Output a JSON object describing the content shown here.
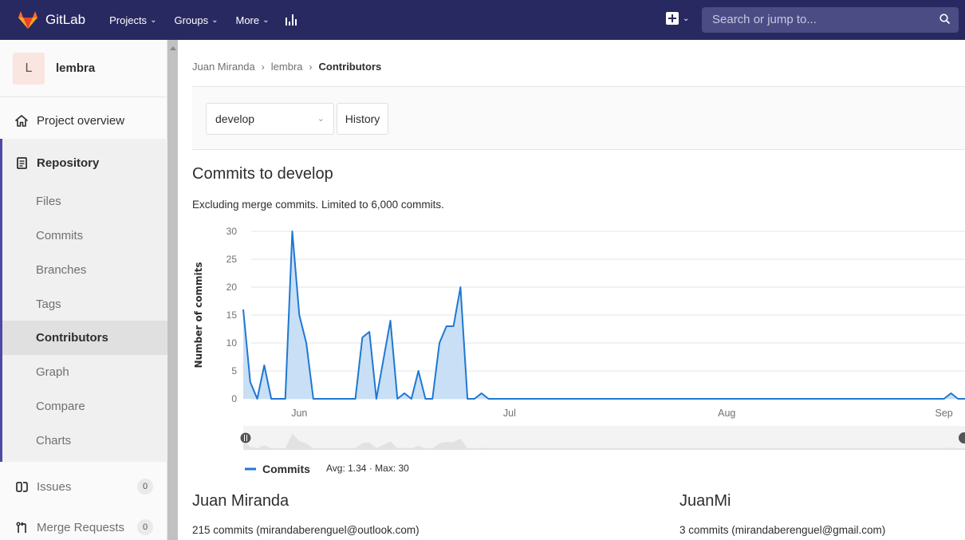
{
  "topbar": {
    "brand": "GitLab",
    "nav": [
      {
        "label": "Projects"
      },
      {
        "label": "Groups"
      },
      {
        "label": "More"
      }
    ],
    "search_placeholder": "Search or jump to...",
    "bg_color": "#292961"
  },
  "sidebar": {
    "project_initial": "L",
    "project_name": "lembra",
    "overview": "Project overview",
    "repository": "Repository",
    "repo_items": [
      "Files",
      "Commits",
      "Branches",
      "Tags",
      "Contributors",
      "Graph",
      "Compare",
      "Charts"
    ],
    "active_item": "Contributors",
    "issues": {
      "label": "Issues",
      "count": "0"
    },
    "merge_requests": {
      "label": "Merge Requests",
      "count": "0"
    }
  },
  "breadcrumb": {
    "items": [
      "Juan Miranda",
      "lembra"
    ],
    "current": "Contributors"
  },
  "controls": {
    "branch": "develop",
    "history_label": "History"
  },
  "section": {
    "title": "Commits to develop",
    "subtitle": "Excluding merge commits. Limited to 6,000 commits."
  },
  "chart_data": {
    "type": "area",
    "ylabel": "Number of commits",
    "ylim": [
      0,
      30
    ],
    "yticks": [
      0,
      5,
      10,
      15,
      20,
      25,
      30
    ],
    "month_labels": [
      {
        "label": "Jun",
        "day_index": 8
      },
      {
        "label": "Jul",
        "day_index": 38
      },
      {
        "label": "Aug",
        "day_index": 69
      },
      {
        "label": "Sep",
        "day_index": 100
      }
    ],
    "values": [
      16,
      3,
      0,
      6,
      0,
      0,
      0,
      30,
      15,
      10,
      0,
      0,
      0,
      0,
      0,
      0,
      0,
      11,
      12,
      0,
      7,
      14,
      0,
      1,
      0,
      5,
      0,
      0,
      10,
      13,
      13,
      20,
      0,
      0,
      1,
      0,
      0,
      0,
      0,
      0,
      0,
      0,
      0,
      0,
      0,
      0,
      0,
      0,
      0,
      0,
      0,
      0,
      0,
      0,
      0,
      0,
      0,
      0,
      0,
      0,
      0,
      0,
      0,
      0,
      0,
      0,
      0,
      0,
      0,
      0,
      0,
      0,
      0,
      0,
      0,
      0,
      0,
      0,
      0,
      0,
      0,
      0,
      0,
      0,
      0,
      0,
      0,
      0,
      0,
      0,
      0,
      0,
      0,
      0,
      0,
      0,
      0,
      0,
      0,
      0,
      0,
      1,
      0,
      0
    ],
    "series": [
      {
        "name": "Commits"
      }
    ],
    "legend_stats": "Avg: 1.34 · Max: 30",
    "line_color": "#1f78d1",
    "fill_color": "#c9dff5"
  },
  "contributors": [
    {
      "name": "Juan Miranda",
      "summary": "215 commits (mirandaberenguel@outlook.com)"
    },
    {
      "name": "JuanMi",
      "summary": "3 commits (mirandaberenguel@gmail.com)"
    }
  ]
}
